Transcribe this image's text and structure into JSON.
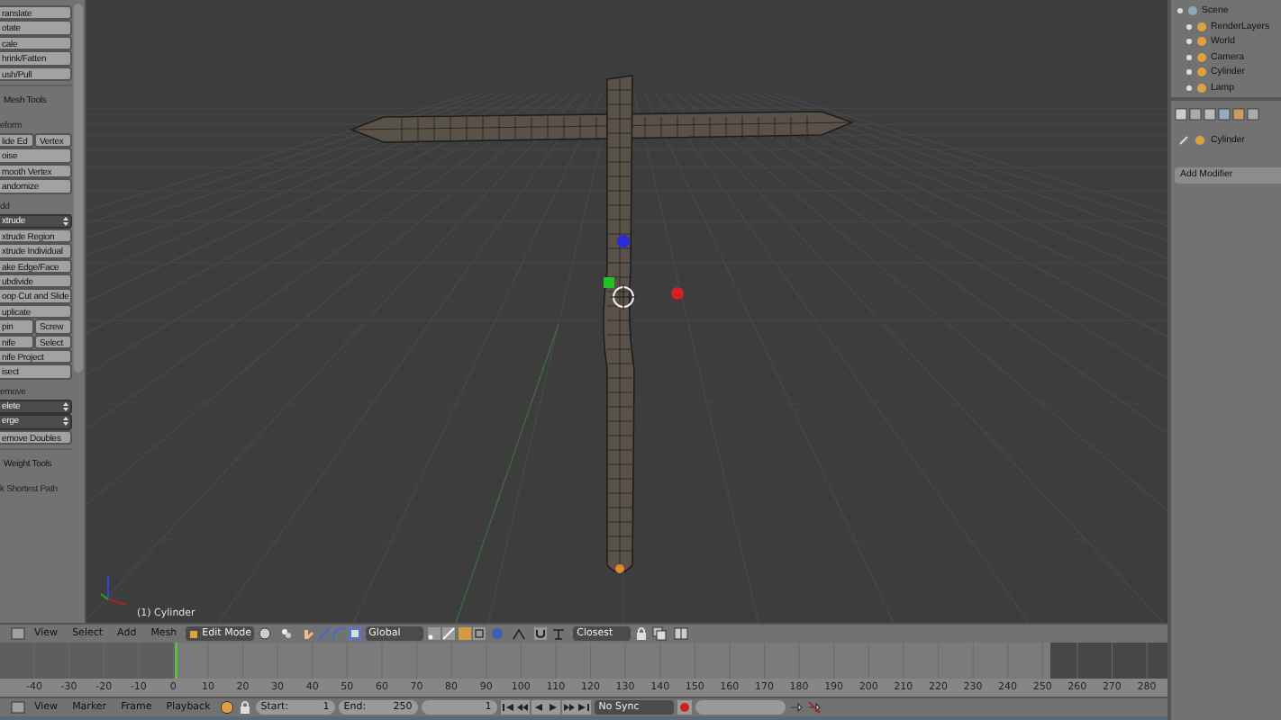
{
  "toolbar": {
    "items": [
      {
        "kind": "button",
        "label": "ranslate"
      },
      {
        "kind": "button",
        "label": "otate"
      },
      {
        "kind": "button",
        "label": "cale"
      },
      {
        "kind": "button",
        "label": "hrink/Fatten"
      },
      {
        "kind": "button",
        "label": "ush/Pull"
      },
      {
        "kind": "heading",
        "label": "Mesh Tools"
      },
      {
        "kind": "label",
        "label": "eform"
      },
      {
        "kind": "pair",
        "labels": [
          "lide Ed",
          "Vertex"
        ]
      },
      {
        "kind": "button",
        "label": "oise"
      },
      {
        "kind": "button",
        "label": "mooth Vertex"
      },
      {
        "kind": "button",
        "label": "andomize"
      },
      {
        "kind": "label",
        "label": "dd"
      },
      {
        "kind": "dropdown",
        "label": "xtrude"
      },
      {
        "kind": "button",
        "label": "xtrude Region"
      },
      {
        "kind": "button",
        "label": "xtrude Individual"
      },
      {
        "kind": "button",
        "label": "ake Edge/Face"
      },
      {
        "kind": "button",
        "label": "ubdivide"
      },
      {
        "kind": "button",
        "label": "oop Cut and Slide"
      },
      {
        "kind": "button",
        "label": "uplicate"
      },
      {
        "kind": "pair",
        "labels": [
          "pin",
          "Screw"
        ]
      },
      {
        "kind": "pair",
        "labels": [
          "nife",
          "Select"
        ]
      },
      {
        "kind": "button",
        "label": "nife Project"
      },
      {
        "kind": "button",
        "label": "isect"
      },
      {
        "kind": "label",
        "label": "emove"
      },
      {
        "kind": "dropdown",
        "label": "elete"
      },
      {
        "kind": "dropdown",
        "label": "erge"
      },
      {
        "kind": "button",
        "label": "emove Doubles"
      },
      {
        "kind": "heading",
        "label": "Weight Tools"
      },
      {
        "kind": "label",
        "label": "k Shortest Path"
      }
    ]
  },
  "viewport": {
    "object_label": "(1) Cylinder"
  },
  "view3d_header": {
    "menus": [
      "View",
      "Select",
      "Add",
      "Mesh"
    ],
    "mode": "Edit Mode",
    "orientation": "Global",
    "snap_element": "Closest"
  },
  "timeline": {
    "ticks": [
      "-40",
      "-30",
      "-20",
      "-10",
      "0",
      "10",
      "20",
      "30",
      "40",
      "50",
      "60",
      "70",
      "80",
      "90",
      "100",
      "110",
      "120",
      "130",
      "140",
      "150",
      "160",
      "170",
      "180",
      "190",
      "200",
      "210",
      "220",
      "230",
      "240",
      "250",
      "260",
      "270",
      "280"
    ]
  },
  "timeline_header": {
    "menus": [
      "View",
      "Marker",
      "Frame",
      "Playback"
    ],
    "start_label": "Start:",
    "start": "1",
    "end_label": "End:",
    "end": "250",
    "current_frame": "1",
    "sync": "No Sync"
  },
  "outliner": {
    "tree": [
      {
        "label": "Scene",
        "children": [
          {
            "label": "RenderLayers"
          },
          {
            "label": "World"
          },
          {
            "label": "Camera"
          },
          {
            "label": "Cylinder"
          },
          {
            "label": "Lamp"
          }
        ]
      }
    ]
  },
  "properties": {
    "breadcrumb": "Cylinder",
    "add_modifier": "Add Modifier"
  }
}
